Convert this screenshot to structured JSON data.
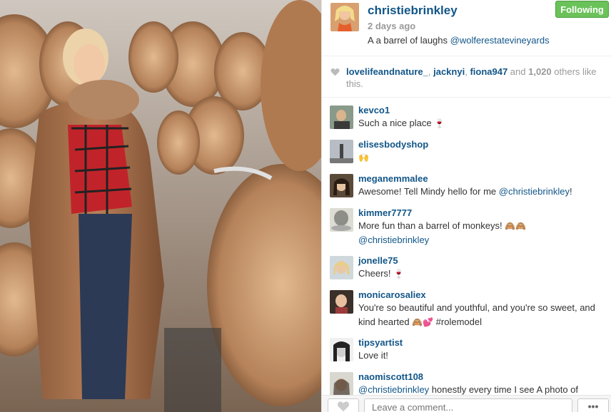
{
  "post": {
    "author": "christiebrinkley",
    "time_ago": "2 days ago",
    "caption_text": "A a barrel of laughs ",
    "caption_mention": "@wolferestatevineyards",
    "follow_label": "Following"
  },
  "likes": {
    "users": [
      "lovelifeandnature_",
      "jacknyi",
      "fiona947"
    ],
    "sep1": ", ",
    "sep2": ", ",
    "and_text": " and ",
    "others_count": "1,020",
    "suffix": " others like this."
  },
  "comments": [
    {
      "user": "kevco1",
      "text": "Such a nice place",
      "emoji": "🍷"
    },
    {
      "user": "elisesbodyshop",
      "text": "",
      "emoji": "🙌"
    },
    {
      "user": "meganemmalee",
      "text": "Awesome! Tell Mindy hello for me ",
      "mention": "@christiebrinkley",
      "after": "!"
    },
    {
      "user": "kimmer7777",
      "text": "More fun than a barrel of monkeys! ",
      "emoji": "🙈🙈",
      "mention": "@christiebrinkley"
    },
    {
      "user": "jonelle75",
      "text": "Cheers! ",
      "emoji": "🍷"
    },
    {
      "user": "monicarosaliex",
      "text": "You're so beautiful and youthful, and you're so sweet, and kind hearted ",
      "emoji": "🙈💕",
      "after": " #rolemodel"
    },
    {
      "user": "tipsyartist",
      "text": "Love it!"
    },
    {
      "user": "naomiscott108",
      "mention": "@christiebrinkley",
      "text": " honestly every time I see A photo of"
    }
  ],
  "footer": {
    "comment_placeholder": "Leave a comment...",
    "more_label": "•••"
  },
  "colors": {
    "link": "#125688",
    "follow_green": "#6ac259"
  },
  "icons": {
    "like": "heart-icon",
    "more": "ellipsis-icon"
  }
}
